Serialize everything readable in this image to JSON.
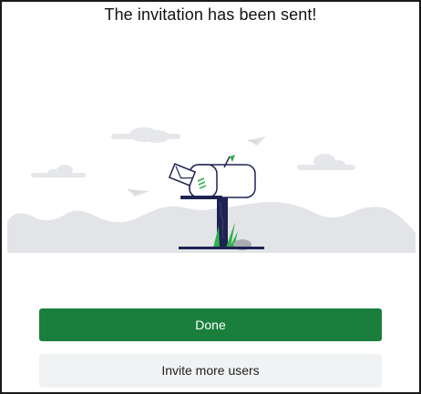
{
  "dialog": {
    "title": "The invitation has been sent!",
    "illustration_icon": "mailbox-with-envelope"
  },
  "actions": {
    "done_label": "Done",
    "invite_more_label": "Invite more users"
  },
  "colors": {
    "primary": "#1a7f3c",
    "secondary_bg": "#f1f2f4",
    "hills": "#e3e4e7",
    "post": "#1e2352",
    "grass": "#2fb24c"
  }
}
